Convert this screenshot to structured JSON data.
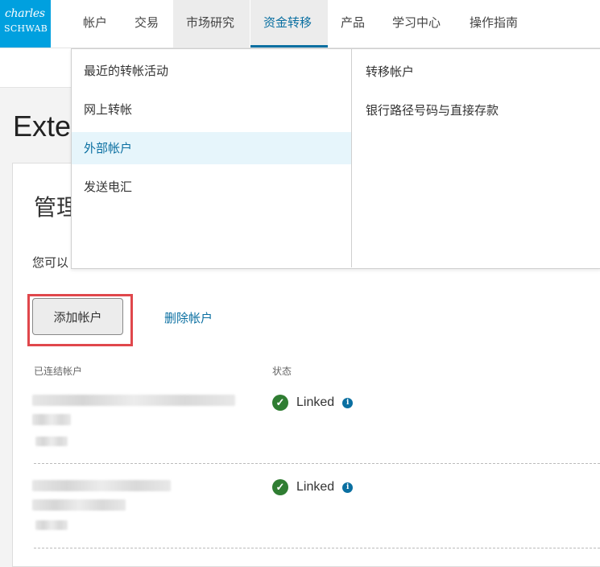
{
  "logo": {
    "line1": "charles",
    "line2": "SCHWAB"
  },
  "nav": {
    "items": [
      "帐户",
      "交易",
      "市场研究",
      "资金转移",
      "产品",
      "学习中心",
      "操作指南"
    ]
  },
  "dropdown": {
    "left_items": [
      "最近的转帐活动",
      "网上转帐",
      "外部帐户",
      "发送电汇"
    ],
    "right_items": [
      "转移帐户",
      "银行路径号码与直接存款"
    ]
  },
  "page": {
    "title": "Exter"
  },
  "card": {
    "title": "管理",
    "desc": "您可以",
    "add_button": "添加帐户",
    "remove_link": "删除帐户",
    "col_linked": "已连结帐户",
    "col_status": "状态",
    "rows": [
      {
        "status": "Linked"
      },
      {
        "status": "Linked"
      }
    ]
  },
  "colors": {
    "brand": "#00a0df",
    "accent": "#0a6fa1",
    "success": "#2f7d32",
    "highlight": "#e0474c"
  },
  "icons": {
    "check": "check-circle-icon",
    "info": "info-icon"
  }
}
